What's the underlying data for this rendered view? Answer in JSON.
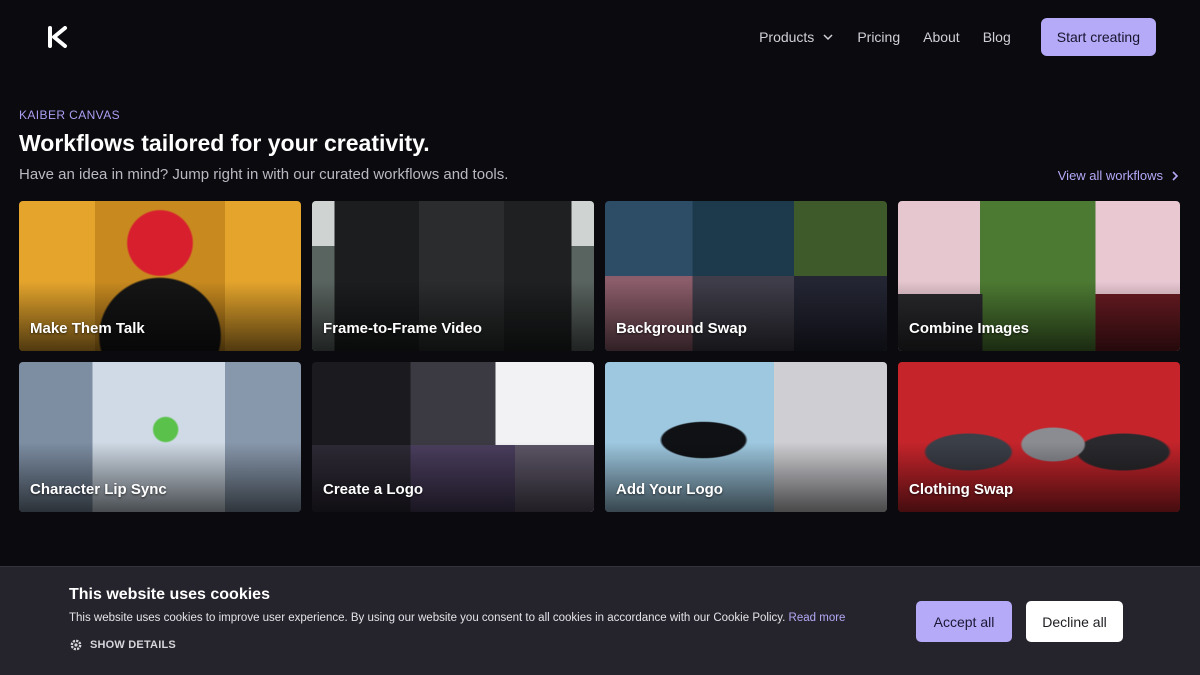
{
  "nav": {
    "logo_icon": "kaiber-k-logo-icon",
    "links": [
      {
        "label": "Products",
        "has_dropdown": true
      },
      {
        "label": "Pricing"
      },
      {
        "label": "About"
      },
      {
        "label": "Blog"
      }
    ],
    "cta_label": "Start creating"
  },
  "header": {
    "eyebrow": "KAIBER CANVAS",
    "title": "Workflows tailored for your creativity.",
    "subtitle": "Have an idea in mind? Jump right in with our curated workflows and tools.",
    "view_all": "View all workflows"
  },
  "workflows": [
    {
      "label": "Make Them Talk"
    },
    {
      "label": "Frame-to-Frame Video"
    },
    {
      "label": "Background Swap"
    },
    {
      "label": "Combine Images"
    },
    {
      "label": "Character Lip Sync"
    },
    {
      "label": "Create a Logo"
    },
    {
      "label": "Add Your Logo"
    },
    {
      "label": "Clothing Swap"
    }
  ],
  "cookie": {
    "title": "This website uses cookies",
    "text": "This website uses cookies to improve user experience. By using our website you consent to all cookies in accordance with our Cookie Policy.",
    "read_more": "Read more",
    "show_details": "SHOW DETAILS",
    "accept": "Accept all",
    "decline": "Decline all"
  },
  "colors": {
    "background": "#0b0a0f",
    "accent": "#b4aaf7",
    "cookie_bar": "#25242c"
  }
}
